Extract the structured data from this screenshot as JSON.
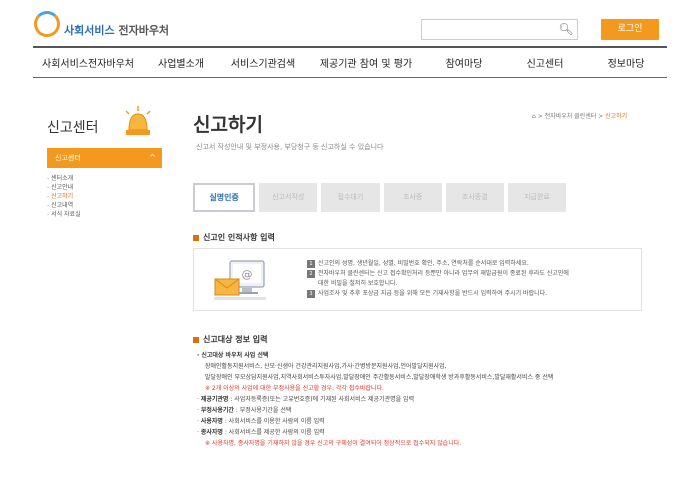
{
  "header": {
    "logo_text": "사회서비스",
    "logo_text_bold": "전자바우처",
    "search_placeholder": "",
    "login_label": "로그인"
  },
  "gnb": [
    "사회서비스전자바우처",
    "사업별소개",
    "서비스기관검색",
    "제공기관 참여 및 평가",
    "참여마당",
    "신고센터",
    "정보마당"
  ],
  "side": {
    "title": "신고센터",
    "menu_head": "신고센터",
    "items": [
      "센터소개",
      "신고안내",
      "신고하기",
      "신고내역",
      "서식 자료실"
    ],
    "active_index": 2
  },
  "main": {
    "title": "신고하기",
    "subtitle": "신고서 작성안내 및 부정사용, 부당청구 등 신고하실 수 있습니다",
    "breadcrumb": [
      "전자바우처 클린센터",
      "신고하기"
    ],
    "steps": [
      "실명인증",
      "신고서작성",
      "접수대기",
      "조사중",
      "조사종결",
      "지급완료"
    ],
    "active_step": 0,
    "section1_title": "신고인 인적사항 입력",
    "notices": [
      "신고인의 성명, 생년월일, 성별, 비밀번호 확인, 주소, 연락처를 순서대로 입력하세요.",
      "전자바우처 클린센터는 신고 접수확인처리 등뿐만 아니라 업무의 재발급원이 종료된 후라도 신고인에",
      "대한 비밀을 철저히 보호합니다.",
      "사업조사 및 추후 포상금 지급 등을 위해 모든 기재사항을 반드시 입력하여 주시기 바랍니다."
    ],
    "section2_title": "신고대상 정보 입력",
    "info": {
      "l1": "신고대상 바우처 사업 선택",
      "l2": "장애인활동지원서비스, 산모·신생아 건강관리지원사업,가사·간병방문지원사업,언어발달지원사업,",
      "l3": "발달장애인 부모상담지원사업,지역사회서비스투자사업,발달장애인 주간활동서비스,발달장애학생 방과후활동서비스,발달재활서비스 중 선택",
      "l4": "※ 2개 이상의 사업에 대한 부정사용을 신고할 경우, 각각 접수바랍니다.",
      "l5a": "제공기관명",
      "l5b": " : 사업자등록증(또는 고유번호증)에 기재된 사회서비스 제공기관명을 입력",
      "l6a": "부정사용기간",
      "l6b": " : 부정사용기간을 선택",
      "l7a": "사용자명",
      "l7b": " : 사회서비스를 이용한 사람의 이름 입력",
      "l8a": "종사자명",
      "l8b": " : 사회서비스를 제공한 사람의 이름 입력",
      "l9": "※ 사용자명, 종사자명을 기재하지 않을 경우 신고의 구체성이 결여되어 정상적으로 접수되지 않습니다."
    }
  },
  "colors": {
    "accent": "#f39a1e",
    "brand": "#2d6fb7",
    "alert": "#e4362b"
  }
}
